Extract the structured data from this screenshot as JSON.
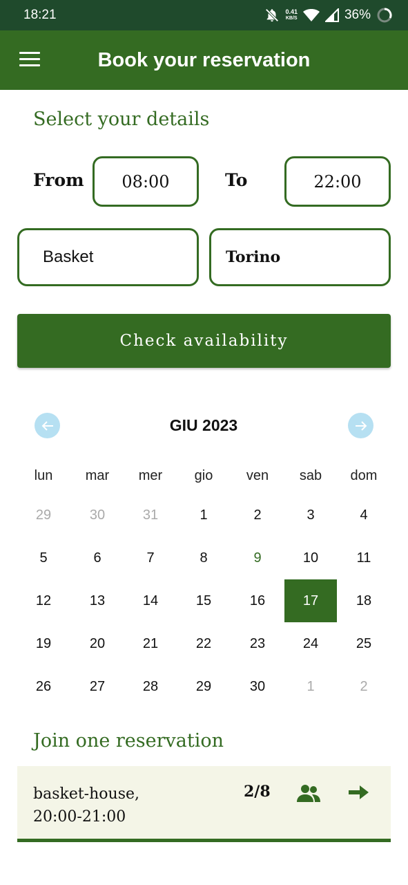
{
  "status_bar": {
    "time": "18:21",
    "speed_value": "0.41",
    "speed_unit": "KB/S",
    "battery": "36%"
  },
  "app_bar": {
    "title": "Book your reservation",
    "menu_icon": "hamburger-menu-icon"
  },
  "details": {
    "heading": "Select your details",
    "from_label": "From",
    "from_value": "08:00",
    "to_label": "To",
    "to_value": "22:00",
    "sport_value": "Basket",
    "city_value": "Torino",
    "check_button": "Check availability"
  },
  "calendar": {
    "month_label": "GIU 2023",
    "prev_icon": "arrow-left-icon",
    "next_icon": "arrow-right-icon",
    "weekdays": [
      "lun",
      "mar",
      "mer",
      "gio",
      "ven",
      "sab",
      "dom"
    ],
    "weeks": [
      [
        "29",
        "30",
        "31",
        "1",
        "2",
        "3",
        "4"
      ],
      [
        "5",
        "6",
        "7",
        "8",
        "9",
        "10",
        "11"
      ],
      [
        "12",
        "13",
        "14",
        "15",
        "16",
        "17",
        "18"
      ],
      [
        "19",
        "20",
        "21",
        "22",
        "23",
        "24",
        "25"
      ],
      [
        "26",
        "27",
        "28",
        "29",
        "30",
        "1",
        "2"
      ]
    ],
    "today": "9",
    "selected": "17",
    "colors": {
      "selected_bg": "#346b22",
      "nav_bg": "#b6e0f2",
      "muted": "#aaaaaa"
    }
  },
  "join": {
    "heading": "Join one reservation",
    "reservations": [
      {
        "name_line1": "basket-house,",
        "name_line2": "20:00-21:00",
        "participants": "2/8",
        "people_icon": "people-icon",
        "action_icon": "arrow-right-icon"
      }
    ]
  },
  "colors": {
    "primary": "#346b22",
    "status_bar": "#1f4a2c",
    "card_bg": "#f4f5e7"
  }
}
